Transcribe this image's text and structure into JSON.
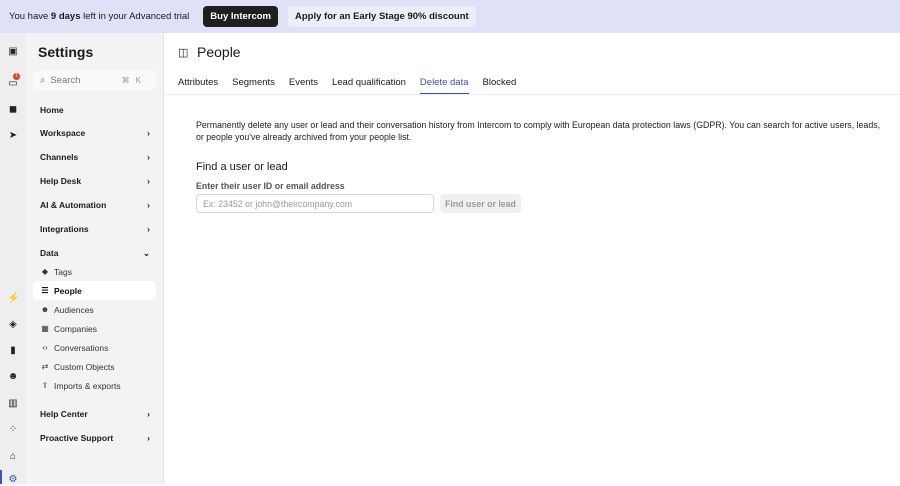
{
  "banner": {
    "prefix": "You have",
    "days": "9 days",
    "suffix": "left in your Advanced trial",
    "buy": "Buy Intercom",
    "discount": "Apply for an Early Stage 90% discount"
  },
  "rail": {
    "notification_count": "1"
  },
  "sidebar": {
    "title": "Settings",
    "search_placeholder": "Search",
    "shortcut": "⌘K",
    "sections": [
      {
        "label": "Home"
      },
      {
        "label": "Workspace"
      },
      {
        "label": "Channels"
      },
      {
        "label": "Help Desk"
      },
      {
        "label": "AI & Automation"
      },
      {
        "label": "Integrations"
      },
      {
        "label": "Data"
      }
    ],
    "data_items": [
      {
        "label": "Tags"
      },
      {
        "label": "People"
      },
      {
        "label": "Audiences"
      },
      {
        "label": "Companies"
      },
      {
        "label": "Conversations"
      },
      {
        "label": "Custom Objects"
      },
      {
        "label": "Imports & exports"
      }
    ],
    "bottom_sections": [
      {
        "label": "Help Center"
      },
      {
        "label": "Proactive Support"
      }
    ]
  },
  "main": {
    "title": "People",
    "tabs": [
      {
        "label": "Attributes"
      },
      {
        "label": "Segments"
      },
      {
        "label": "Events"
      },
      {
        "label": "Lead qualification"
      },
      {
        "label": "Delete data"
      },
      {
        "label": "Blocked"
      }
    ],
    "description": "Permanently delete any user or lead and their conversation history from Intercom to comply with European data protection laws (GDPR). You can search for active users, leads, or people you've already archived from your people list.",
    "find_heading": "Find a user or lead",
    "field_label": "Enter their user ID or email address",
    "field_placeholder": "Ex: 23452 or john@theircompany.com",
    "field_value": "",
    "find_button": "Find user or lead"
  },
  "colors": {
    "accent": "#3d4cc8",
    "banner": "#dfe2f6"
  }
}
